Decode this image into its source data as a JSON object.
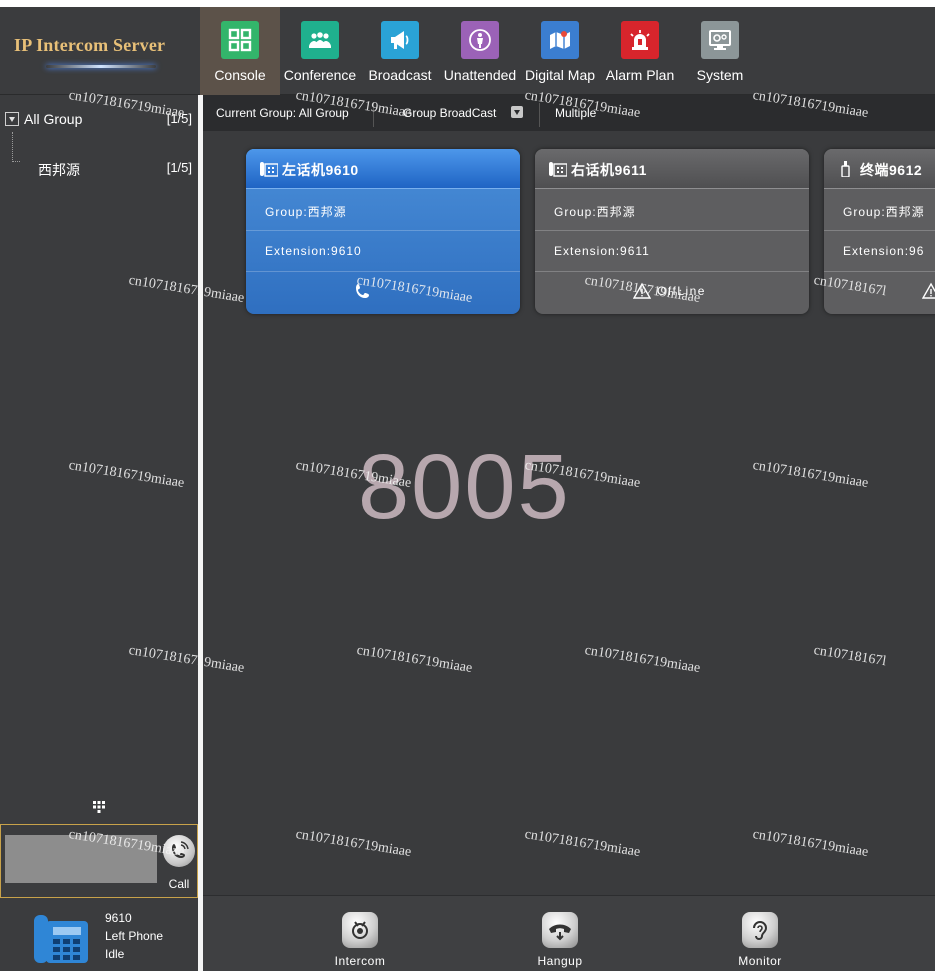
{
  "app": {
    "title": "IP Intercom Server"
  },
  "nav": {
    "items": [
      {
        "label": "Console",
        "icon": "console-grid-icon",
        "color": "#33b56b",
        "active": true
      },
      {
        "label": "Conference",
        "icon": "conference-people-icon",
        "color": "#1fb08e"
      },
      {
        "label": "Broadcast",
        "icon": "megaphone-icon",
        "color": "#2aa3d6"
      },
      {
        "label": "Unattended",
        "icon": "unattended-person-icon",
        "color": "#9b62b7"
      },
      {
        "label": "Digital Map",
        "icon": "map-icon",
        "color": "#3b7ed0"
      },
      {
        "label": "Alarm Plan",
        "icon": "alarm-siren-icon",
        "color": "#d7252c"
      },
      {
        "label": "System",
        "icon": "system-monitor-icon",
        "color": "#8c9698"
      }
    ]
  },
  "tree": {
    "root_label": "All Group",
    "root_count": "[1/5]",
    "children": [
      {
        "label": "西邦源",
        "count": "[1/5]"
      }
    ]
  },
  "dialer": {
    "input_value": "",
    "call_label": "Call"
  },
  "local_phone": {
    "extension": "9610",
    "name": "Left Phone",
    "status": "Idle"
  },
  "toolbar": {
    "current_group": "Current Group:  All Group",
    "group_broadcast": "Group BroadCast",
    "multiple": "Multiple"
  },
  "cards": [
    {
      "title": "左话机9610",
      "group": "Group:西邦源",
      "extension": "Extension:9610",
      "status": "",
      "state": "online",
      "device_icon": "desk-phone-icon",
      "status_icon": "phone-handset-icon"
    },
    {
      "title": "右话机9611",
      "group": "Group:西邦源",
      "extension": "Extension:9611",
      "status": "OffLine",
      "state": "offline",
      "device_icon": "desk-phone-icon",
      "status_icon": "warning-icon"
    },
    {
      "title": "终端9612",
      "group": "Group:西邦源",
      "extension": "Extension:96",
      "status": "",
      "state": "offline",
      "device_icon": "terminal-icon",
      "status_icon": "warning-icon"
    }
  ],
  "display_number": "8005",
  "bottom_actions": [
    {
      "label": "Intercom",
      "icon": "intercom-icon"
    },
    {
      "label": "Hangup",
      "icon": "hangup-icon"
    },
    {
      "label": "Monitor",
      "icon": "monitor-ear-icon"
    }
  ],
  "watermark": {
    "text": "cn1071816719miaae",
    "text_short": "cn10718167l"
  }
}
